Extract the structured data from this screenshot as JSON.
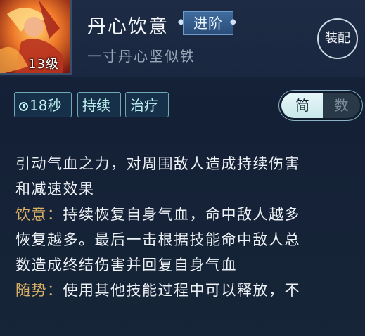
{
  "skill": {
    "name": "丹心饮意",
    "badge": "进阶",
    "subtitle": "一寸丹心坚似铁",
    "level": "13级"
  },
  "equip_label": "装配",
  "tags": {
    "time": "18秒",
    "tag2": "持续",
    "tag3": "治疗"
  },
  "toggle": {
    "active": "简",
    "inactive": "数"
  },
  "description": {
    "line1": "引动气血之力，对周围敌人造成持续伤害",
    "line2": "和减速效果",
    "p2_label": "饮意：",
    "p2_line1": "持续恢复自身气血，命中敌人越多",
    "p2_line2": "恢复越多。最后一击根据技能命中敌人总",
    "p2_line3": "数造成终结伤害并回复自身气血",
    "p3_label": "随势：",
    "p3_line1": "使用其他技能过程中可以释放，不"
  },
  "colors": {
    "highlight": "#d9b066",
    "tag_text": "#bff2f2",
    "badge_bg": "#3f6c9e"
  }
}
